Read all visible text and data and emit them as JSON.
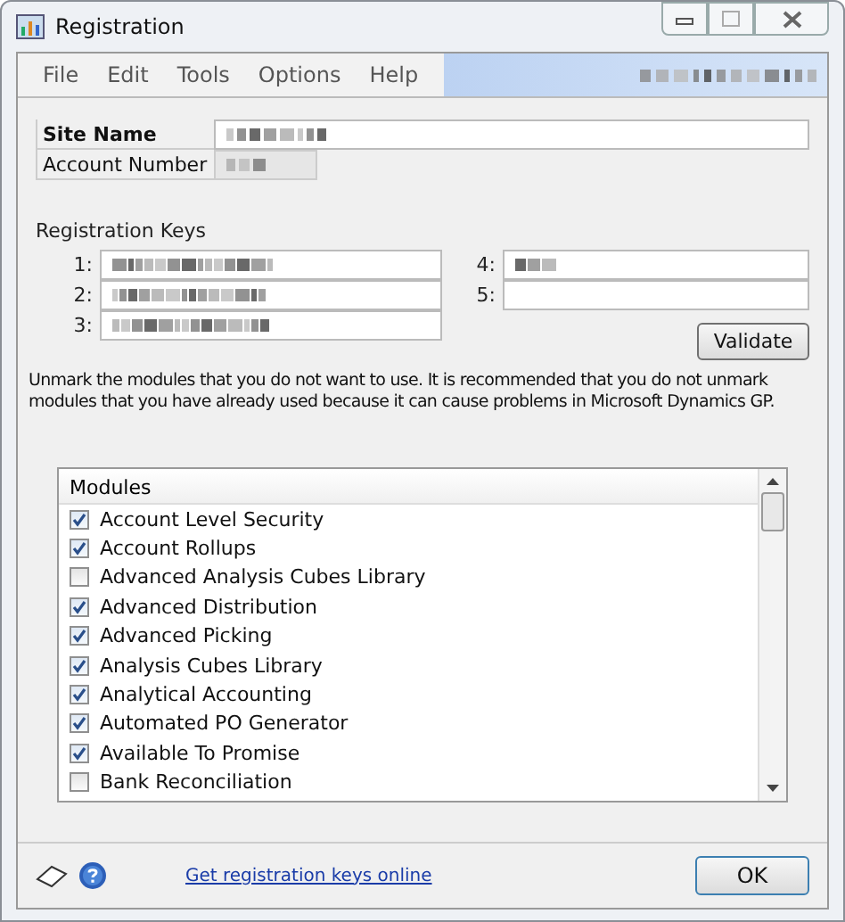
{
  "window": {
    "title": "Registration"
  },
  "menu": [
    "File",
    "Edit",
    "Tools",
    "Options",
    "Help"
  ],
  "fields": [
    {
      "label": "Site Name",
      "bold": true
    },
    {
      "label": "Account Number",
      "bold": false
    }
  ],
  "registration_keys": {
    "label": "Registration Keys",
    "left": [
      "1:",
      "2:",
      "3:"
    ],
    "right": [
      "4:",
      "5:"
    ]
  },
  "validate_button": "Validate",
  "instructions": "Unmark the modules that you do not want to use. It is recommended that you do not unmark modules that you have already used because it can cause problems in Microsoft Dynamics GP.",
  "modules": {
    "header": "Modules",
    "items": [
      {
        "name": "Account Level Security",
        "checked": true
      },
      {
        "name": "Account Rollups",
        "checked": true
      },
      {
        "name": "Advanced Analysis Cubes Library",
        "checked": false
      },
      {
        "name": "Advanced Distribution",
        "checked": true
      },
      {
        "name": "Advanced Picking",
        "checked": true
      },
      {
        "name": "Analysis Cubes Library",
        "checked": true
      },
      {
        "name": "Analytical Accounting",
        "checked": true
      },
      {
        "name": "Automated PO Generator",
        "checked": true
      },
      {
        "name": "Available To Promise",
        "checked": true
      },
      {
        "name": "Bank Reconciliation",
        "checked": false
      }
    ]
  },
  "footer": {
    "link": "Get registration keys online",
    "ok_button": "OK"
  }
}
